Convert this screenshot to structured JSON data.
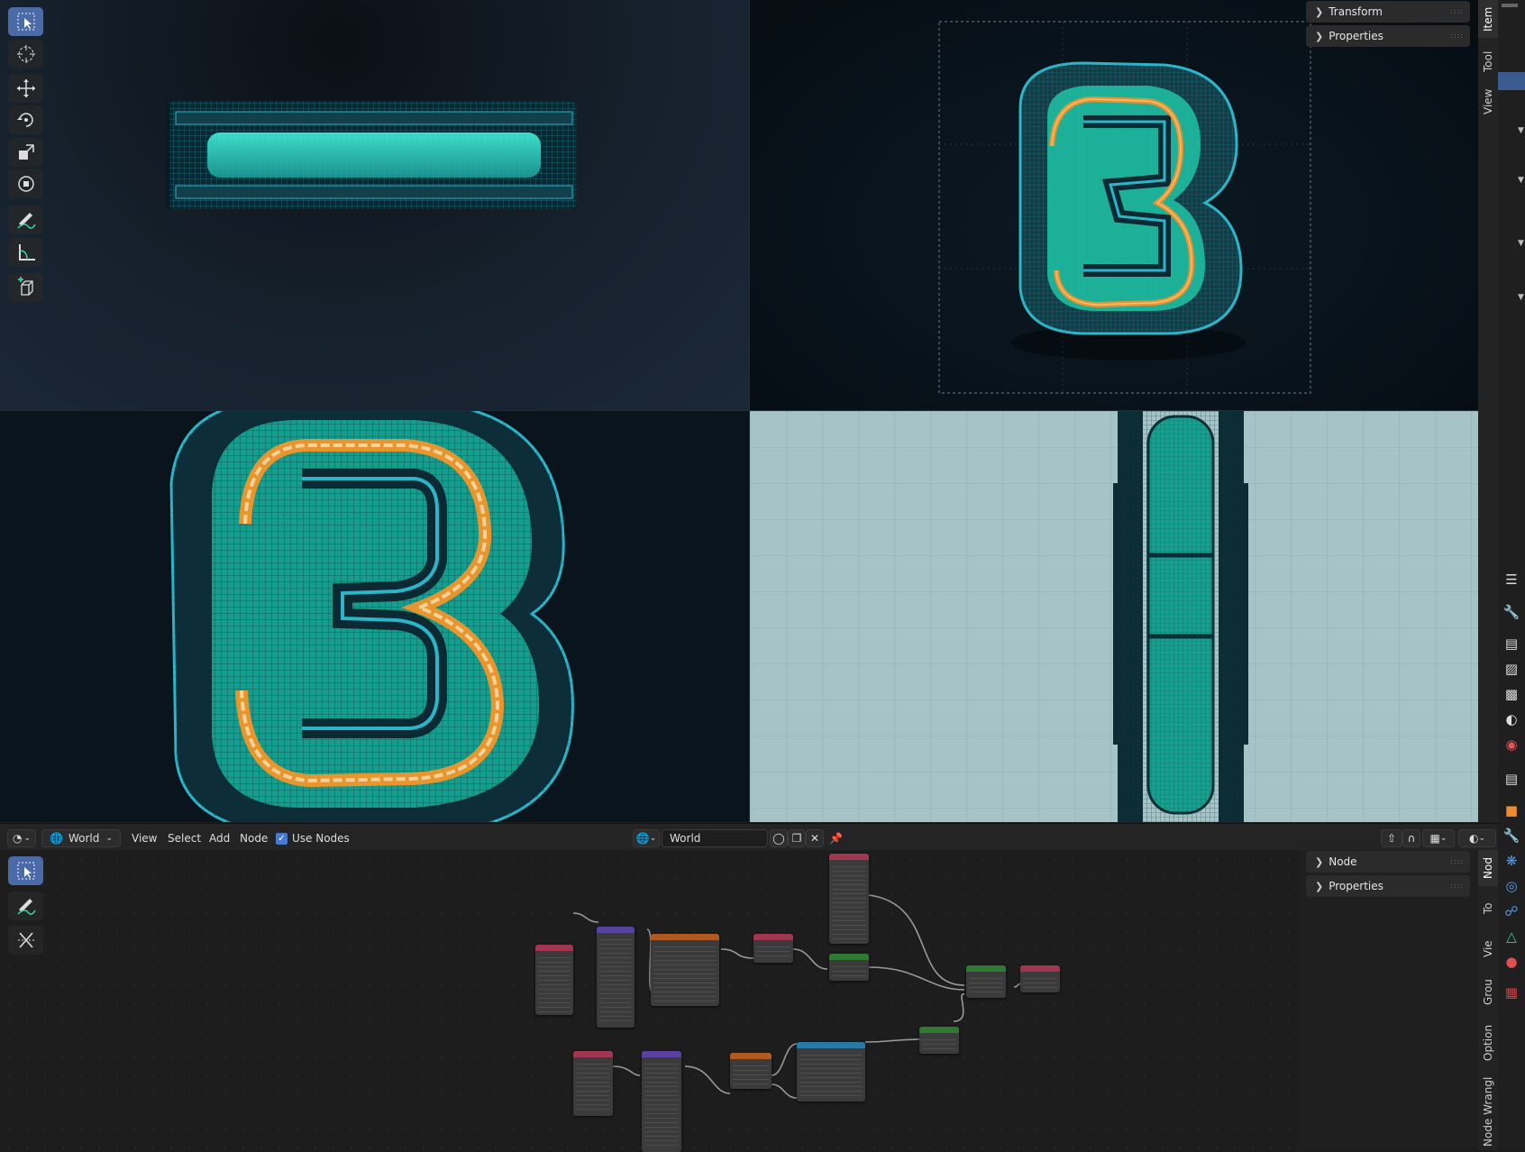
{
  "toolbar3d": {
    "tools": [
      {
        "name": "select-box",
        "icon": "select-box-icon",
        "active": true
      },
      {
        "name": "cursor",
        "icon": "cursor-icon"
      },
      {
        "name": "move",
        "icon": "move-icon"
      },
      {
        "name": "rotate",
        "icon": "rotate-icon"
      },
      {
        "name": "scale",
        "icon": "scale-icon"
      },
      {
        "name": "transform",
        "icon": "transform-icon"
      },
      {
        "name": "annotate",
        "icon": "annotate-icon"
      },
      {
        "name": "measure",
        "icon": "measure-icon"
      },
      {
        "name": "add-cube",
        "icon": "add-cube-icon"
      }
    ]
  },
  "npanel_top": {
    "panels": [
      "Transform",
      "Properties"
    ],
    "tabs": [
      "Item",
      "Tool",
      "View"
    ]
  },
  "node_editor": {
    "editor_type_icon": "node-editor-icon",
    "shader_type": "World",
    "menus": [
      "View",
      "Select",
      "Add",
      "Node"
    ],
    "use_nodes_label": "Use Nodes",
    "use_nodes_checked": true,
    "world_name": "World",
    "npanel": {
      "panels": [
        "Node",
        "Properties"
      ],
      "tabs": [
        "Nod",
        "To",
        "Vie",
        "Grou",
        "Option",
        "Node Wrangl"
      ]
    }
  },
  "properties_icons": [
    "tool-icon",
    "render-icon",
    "output-icon",
    "view-layer-icon",
    "scene-icon",
    "world-icon",
    "collection-icon",
    "object-icon",
    "modifier-icon",
    "particles-icon",
    "physics-icon",
    "constraints-icon",
    "data-icon",
    "material-icon",
    "texture-icon"
  ],
  "colors": {
    "accent": "#4a6aa8",
    "selection_orange": "#e8952d",
    "mesh_teal": "#1fb89a",
    "wire_cyan": "#2fb6c9",
    "ortho_bg": "#a6c4c8"
  }
}
